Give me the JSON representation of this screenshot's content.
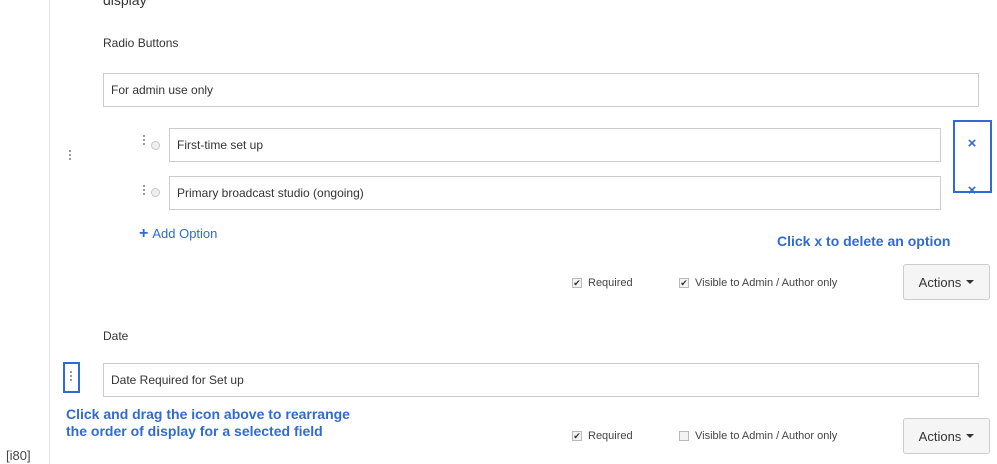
{
  "top_partial_text": "display",
  "radio_section": {
    "label": "Radio Buttons",
    "question_value": "For admin use only",
    "options": [
      {
        "value": "First-time set up"
      },
      {
        "value": "Primary broadcast studio (ongoing)"
      }
    ],
    "delete_icon": "x-icon",
    "add_option_label": "Add Option",
    "add_option_icon": "plus-icon",
    "required": {
      "label": "Required",
      "checked": true
    },
    "visible": {
      "label": "Visible to Admin / Author only",
      "checked": true
    },
    "actions_label": "Actions"
  },
  "date_section": {
    "label": "Date",
    "question_value": "Date Required for Set up",
    "required": {
      "label": "Required",
      "checked": true
    },
    "visible": {
      "label": "Visible to Admin / Author only",
      "checked": false
    },
    "actions_label": "Actions"
  },
  "callouts": {
    "delete_option": "Click x to delete an option",
    "drag_line1": "Click and drag the icon above to rearrange",
    "drag_line2": "the order of display for a selected field"
  },
  "page_number": "[i80]",
  "colors": {
    "accent": "#2f6bd0",
    "border": "#cccccc",
    "text": "#333333"
  }
}
